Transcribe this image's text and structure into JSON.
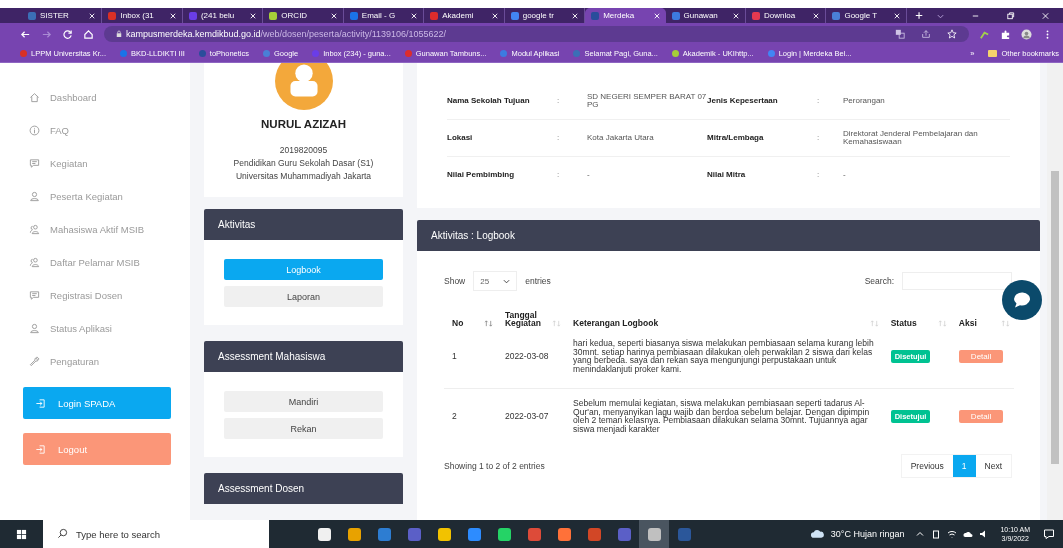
{
  "browser": {
    "tabs": [
      {
        "title": "SISTER",
        "selected": false
      },
      {
        "title": "Inbox (31",
        "selected": false
      },
      {
        "title": "(241 belu",
        "selected": false
      },
      {
        "title": "ORCID",
        "selected": false
      },
      {
        "title": "Email - G",
        "selected": false
      },
      {
        "title": "Akademi",
        "selected": false
      },
      {
        "title": "google tr",
        "selected": false
      },
      {
        "title": "Merdeka",
        "selected": true
      },
      {
        "title": "Gunawan",
        "selected": false
      },
      {
        "title": "Downloa",
        "selected": false
      },
      {
        "title": "Google T",
        "selected": false
      }
    ],
    "url": {
      "host": "kampusmerdeka.kemdikbud.go.id",
      "path": "/web/dosen/peserta/activity/1139106/1055622/"
    },
    "bookmarks": [
      "LPPM Universitas Kr...",
      "BKD-LLDIKTI III",
      "toPhonetics",
      "Google",
      "Inbox (234) - guna...",
      "Gunawan Tambuns...",
      "Modul Aplikasi",
      "Selamat Pagi, Guna...",
      "Akademik - UKIhttp...",
      "Login | Merdeka Bel..."
    ],
    "more_bookmarks": "»",
    "other_bookmarks": "Other bookmarks"
  },
  "sidebar": {
    "items": [
      "Dashboard",
      "FAQ",
      "Kegiatan",
      "Peserta Kegiatan",
      "Mahasiswa Aktif MSIB",
      "Daftar Pelamar MSIB",
      "Registrasi Dosen",
      "Status Aplikasi",
      "Pengaturan"
    ],
    "buttons": [
      {
        "label": "Login SPADA",
        "kind": "primary"
      },
      {
        "label": "Logout",
        "kind": "danger"
      }
    ]
  },
  "profile": {
    "name": "NURUL AZIZAH",
    "nim": "2019820095",
    "program": "Pendidikan Guru Sekolah Dasar (S1)",
    "university": "Universitas Muhammadiyah Jakarta"
  },
  "panels": [
    {
      "title": "Aktivitas",
      "buttons": [
        {
          "label": "Logbook",
          "selected": true
        },
        {
          "label": "Laporan",
          "selected": false
        }
      ]
    },
    {
      "title": "Assessment Mahasiswa",
      "buttons": [
        {
          "label": "Mandiri",
          "selected": false
        },
        {
          "label": "Rekan",
          "selected": false
        }
      ]
    },
    {
      "title": "Assessment Dosen"
    }
  ],
  "info": {
    "fields": [
      {
        "label": "Nama Sekolah Tujuan",
        "sep": ":",
        "value": "SD NEGERI SEMPER BARAT 07 PG"
      },
      {
        "label": "Jenis Kepesertaan",
        "sep": ":",
        "value": "Perorangan"
      },
      {
        "label": "Lokasi",
        "sep": ":",
        "value": "Kota Jakarta Utara"
      },
      {
        "label": "Mitra/Lembaga",
        "sep": ":",
        "value": "Direktorat Jenderal Pembelajaran dan Kemahasiswaan"
      },
      {
        "label": "Nilai Pembimbing",
        "sep": ":",
        "value": "-"
      },
      {
        "label": "Nilai Mitra",
        "sep": ":",
        "value": "-"
      }
    ]
  },
  "logbook": {
    "title": "Aktivitas : Logbook",
    "show_label": "Show",
    "page_size": "25",
    "entries_label": "entries",
    "search_label": "Search:",
    "columns": [
      "No",
      "Tanggal Kegiatan",
      "Keterangan Logbook",
      "Status",
      "Aksi"
    ],
    "rows": [
      {
        "no": "1",
        "date": "2022-03-08",
        "text": "hari kedua, seperti biasanya siswa melakukan pembiasaan selama kurang lebih 30mnt. setiap harinya pembiasaan dilakukan oleh perwakilan 2 siswa dari kelas yang berbeda. saya dan rekan saya mengunjungi perpustakaan untuk menindaklanjuti proker kami.",
        "status": "Disetujui",
        "action": "Detail"
      },
      {
        "no": "2",
        "date": "2022-03-07",
        "text": "Sebelum memulai kegiatan, siswa melakukan pembiasaan seperti tadarus Al-Qur'an, menyanyikan lagu wajib dan berdoa sebelum belajar. Dengan dipimpin oleh 2 teman kelasnya. Pembiasaan dilakukan selama 30mnt. Tujuannya agar siswa menjadi karakter",
        "status": "Disetujui",
        "action": "Detail"
      }
    ],
    "summary": "Showing 1 to 2 of 2 entries",
    "pagination": {
      "previous": "Previous",
      "pages": [
        {
          "label": "1",
          "selected": true
        }
      ],
      "next": "Next"
    }
  },
  "taskbar": {
    "search_placeholder": "Type here to search",
    "weather": "30°C Hujan ringan",
    "time": "10:10 AM",
    "date": "3/9/2022"
  }
}
